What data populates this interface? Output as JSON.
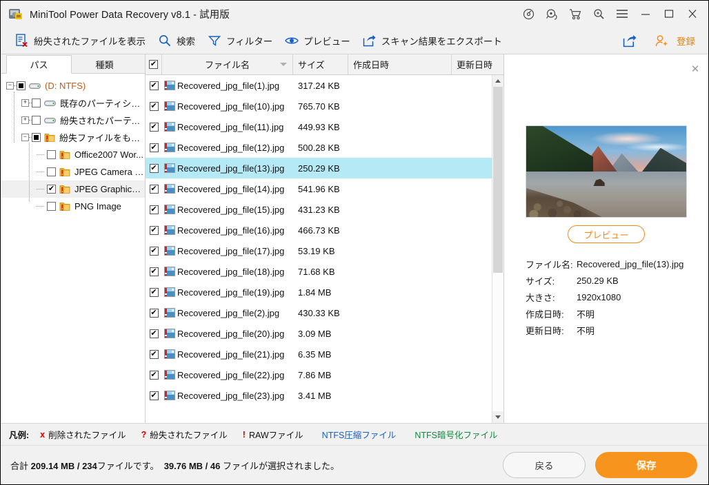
{
  "window": {
    "title": "MiniTool Power Data Recovery v8.1 - 試用版",
    "app_icon": "disk-recovery-icon",
    "controls": [
      {
        "name": "disc-scan-icon",
        "glyph": "disc"
      },
      {
        "name": "support-headset-icon",
        "glyph": "headset"
      },
      {
        "name": "cart-icon",
        "glyph": "cart"
      },
      {
        "name": "search-license-icon",
        "glyph": "magnifier"
      },
      {
        "name": "menu-icon",
        "glyph": "hamburger"
      },
      {
        "name": "minimize-icon",
        "glyph": "minimize"
      },
      {
        "name": "maximize-icon",
        "glyph": "maximize"
      },
      {
        "name": "close-icon",
        "glyph": "close"
      }
    ]
  },
  "toolbar": {
    "items": [
      {
        "label": "紛失されたファイルを表示",
        "icon": "show-lost-files-icon"
      },
      {
        "label": "検索",
        "icon": "search-icon"
      },
      {
        "label": "フィルター",
        "icon": "filter-icon"
      },
      {
        "label": "プレビュー",
        "icon": "preview-eye-icon"
      },
      {
        "label": "スキャン結果をエクスポート",
        "icon": "export-icon"
      }
    ],
    "share_icon": "share-export-icon",
    "register_label": "登録",
    "register_icon": "register-user-icon"
  },
  "tabs": [
    {
      "label": "パス",
      "active": true
    },
    {
      "label": "種類",
      "active": false
    }
  ],
  "tree": [
    {
      "label": "(D: NTFS)",
      "depth": 0,
      "expander": "minus",
      "check": "square",
      "icon": "drive-icon",
      "color": "#c05a17",
      "selected": false
    },
    {
      "label": "既存のパーティション(N...",
      "depth": 1,
      "expander": "plus",
      "check": "empty",
      "icon": "drive-icon",
      "color": "#111111",
      "selected": false
    },
    {
      "label": "紛失されたパーティショ...",
      "depth": 1,
      "expander": "plus",
      "check": "empty",
      "icon": "drive-icon",
      "color": "#111111",
      "selected": false
    },
    {
      "label": "紛失ファイルをもっと表...",
      "depth": 1,
      "expander": "minus",
      "check": "square",
      "icon": "folder-icon",
      "color": "#111111",
      "selected": false
    },
    {
      "label": "Office2007 Wor...",
      "depth": 2,
      "expander": "none",
      "check": "empty",
      "icon": "folder-icon",
      "color": "#111111",
      "selected": false
    },
    {
      "label": "JPEG Camera file",
      "depth": 2,
      "expander": "none",
      "check": "empty",
      "icon": "folder-icon",
      "color": "#111111",
      "selected": false
    },
    {
      "label": "JPEG Graphics ...",
      "depth": 2,
      "expander": "none",
      "check": "checked",
      "icon": "folder-icon",
      "color": "#111111",
      "selected": true
    },
    {
      "label": "PNG Image",
      "depth": 2,
      "expander": "none",
      "check": "empty",
      "icon": "folder-icon",
      "color": "#111111",
      "selected": false
    }
  ],
  "filelist": {
    "columns": [
      {
        "label": "",
        "key": "check"
      },
      {
        "label": "ファイル名",
        "key": "name",
        "sorted": true
      },
      {
        "label": "サイズ",
        "key": "size"
      },
      {
        "label": "作成日時",
        "key": "created"
      },
      {
        "label": "更新日時",
        "key": "modified"
      }
    ],
    "rows": [
      {
        "name": "Recovered_jpg_file(1).jpg",
        "size": "317.24 KB",
        "checked": true,
        "selected": false
      },
      {
        "name": "Recovered_jpg_file(10).jpg",
        "size": "765.70 KB",
        "checked": true,
        "selected": false
      },
      {
        "name": "Recovered_jpg_file(11).jpg",
        "size": "449.93 KB",
        "checked": true,
        "selected": false
      },
      {
        "name": "Recovered_jpg_file(12).jpg",
        "size": "500.28 KB",
        "checked": true,
        "selected": false
      },
      {
        "name": "Recovered_jpg_file(13).jpg",
        "size": "250.29 KB",
        "checked": true,
        "selected": true
      },
      {
        "name": "Recovered_jpg_file(14).jpg",
        "size": "541.96 KB",
        "checked": true,
        "selected": false
      },
      {
        "name": "Recovered_jpg_file(15).jpg",
        "size": "431.23 KB",
        "checked": true,
        "selected": false
      },
      {
        "name": "Recovered_jpg_file(16).jpg",
        "size": "466.73 KB",
        "checked": true,
        "selected": false
      },
      {
        "name": "Recovered_jpg_file(17).jpg",
        "size": "53.19 KB",
        "checked": true,
        "selected": false
      },
      {
        "name": "Recovered_jpg_file(18).jpg",
        "size": "71.68 KB",
        "checked": true,
        "selected": false
      },
      {
        "name": "Recovered_jpg_file(19).jpg",
        "size": "1.84 MB",
        "checked": true,
        "selected": false
      },
      {
        "name": "Recovered_jpg_file(2).jpg",
        "size": "430.33 KB",
        "checked": true,
        "selected": false
      },
      {
        "name": "Recovered_jpg_file(20).jpg",
        "size": "3.09 MB",
        "checked": true,
        "selected": false
      },
      {
        "name": "Recovered_jpg_file(21).jpg",
        "size": "6.35 MB",
        "checked": true,
        "selected": false
      },
      {
        "name": "Recovered_jpg_file(22).jpg",
        "size": "7.86 MB",
        "checked": true,
        "selected": false
      },
      {
        "name": "Recovered_jpg_file(23).jpg",
        "size": "3.41 MB",
        "checked": true,
        "selected": false
      }
    ]
  },
  "preview": {
    "close_icon": "close-icon",
    "image_alt": "lake-sunset-photo",
    "button_label": "プレビュー",
    "meta": [
      {
        "key": "ファイル名:",
        "value": "Recovered_jpg_file(13).jpg"
      },
      {
        "key": "サイズ:",
        "value": "250.29 KB"
      },
      {
        "key": "大きさ:",
        "value": "1920x1080"
      },
      {
        "key": "作成日時:",
        "value": "不明"
      },
      {
        "key": "更新日時:",
        "value": "不明"
      }
    ]
  },
  "legend": {
    "title": "凡例:",
    "items": [
      {
        "mark": "x",
        "label": "削除されたファイル",
        "mark_color": "#d40000",
        "text_color": "#111111"
      },
      {
        "mark": "?",
        "label": "紛失されたファイル",
        "mark_color": "#d40000",
        "text_color": "#111111"
      },
      {
        "mark": "!",
        "label": "RAWファイル",
        "mark_color": "#d40000",
        "text_color": "#111111"
      },
      {
        "mark": "",
        "label": "NTFS圧縮ファイル",
        "mark_color": "#1560c0",
        "text_color": "#1560c0"
      },
      {
        "mark": "",
        "label": "NTFS暗号化ファイル",
        "mark_color": "#0b8a3c",
        "text_color": "#0b8a3c"
      }
    ]
  },
  "status": {
    "total_prefix": "合計",
    "total_size": "209.14 MB / 234",
    "total_suffix": "ファイルです。",
    "selected_size": "39.76 MB / 46",
    "selected_suffix": "ファイルが選択されました。",
    "back_label": "戻る",
    "save_label": "保存"
  },
  "colors": {
    "accent_orange": "#f7941d",
    "selection_blue": "#b5e9f5",
    "toolbar_blue": "#1560c0",
    "chrome_gray": "#f1f1f1"
  }
}
